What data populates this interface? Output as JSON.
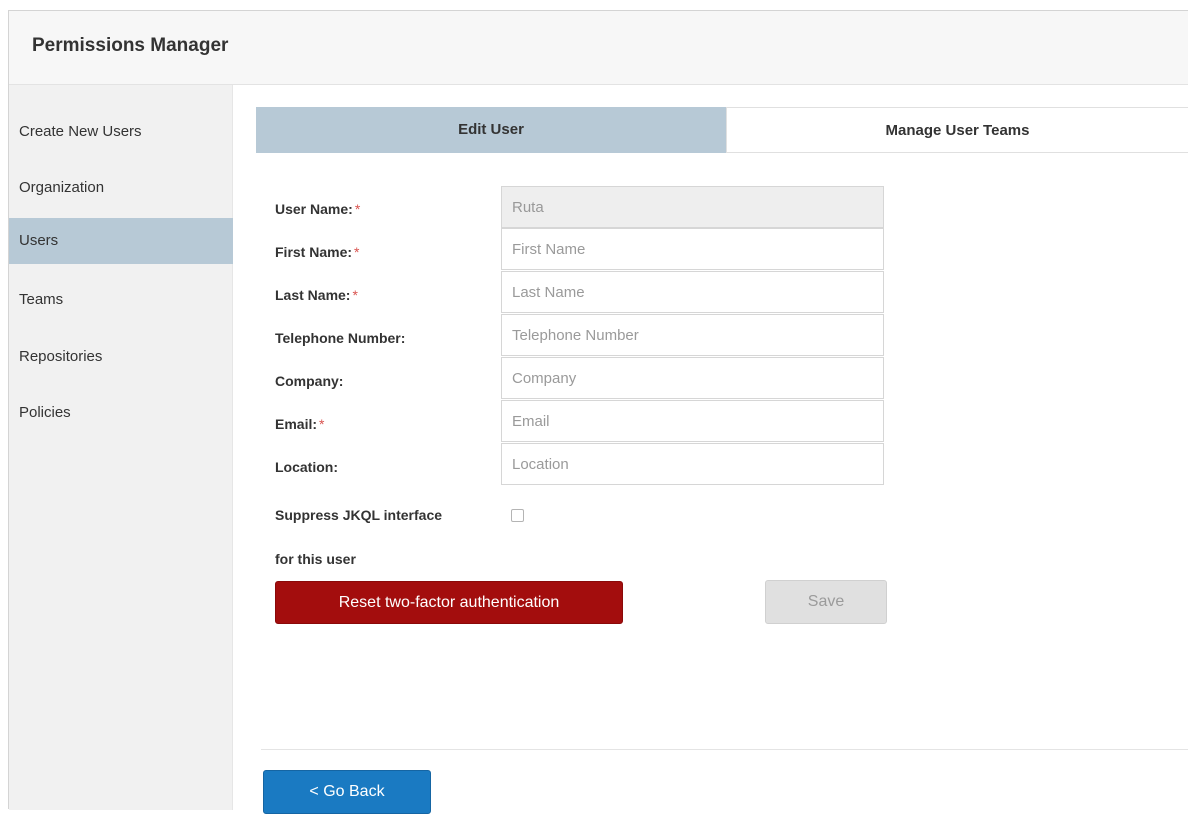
{
  "app": {
    "title": "Permissions Manager"
  },
  "sidebar": {
    "items": [
      {
        "label": "Create New Users",
        "active": false
      },
      {
        "label": "Organization",
        "active": false
      },
      {
        "label": "Users",
        "active": true
      },
      {
        "label": "Teams",
        "active": false
      },
      {
        "label": "Repositories",
        "active": false
      },
      {
        "label": "Policies",
        "active": false
      }
    ]
  },
  "tabs": [
    {
      "label": "Edit User",
      "active": true
    },
    {
      "label": "Manage User Teams",
      "active": false
    }
  ],
  "form": {
    "required_marker": "*",
    "username": {
      "label": "User Name:",
      "value": "Ruta"
    },
    "first_name": {
      "label": "First Name:",
      "placeholder": "First Name"
    },
    "last_name": {
      "label": "Last Name:",
      "placeholder": "Last Name"
    },
    "telephone": {
      "label": "Telephone Number:",
      "placeholder": "Telephone Number"
    },
    "company": {
      "label": "Company:",
      "placeholder": "Company"
    },
    "email": {
      "label": "Email:",
      "placeholder": "Email"
    },
    "location": {
      "label": "Location:",
      "placeholder": "Location"
    },
    "suppress": {
      "label_line1": "Suppress JKQL interface",
      "label_line2": "for this user",
      "checked": false
    }
  },
  "buttons": {
    "reset_2fa": "Reset two-factor authentication",
    "save": "Save",
    "go_back": "< Go Back"
  },
  "colors": {
    "accent_active": "#b7c9d6",
    "danger": "#a30d0d",
    "primary": "#1a7ac2",
    "required": "#d9534f"
  }
}
